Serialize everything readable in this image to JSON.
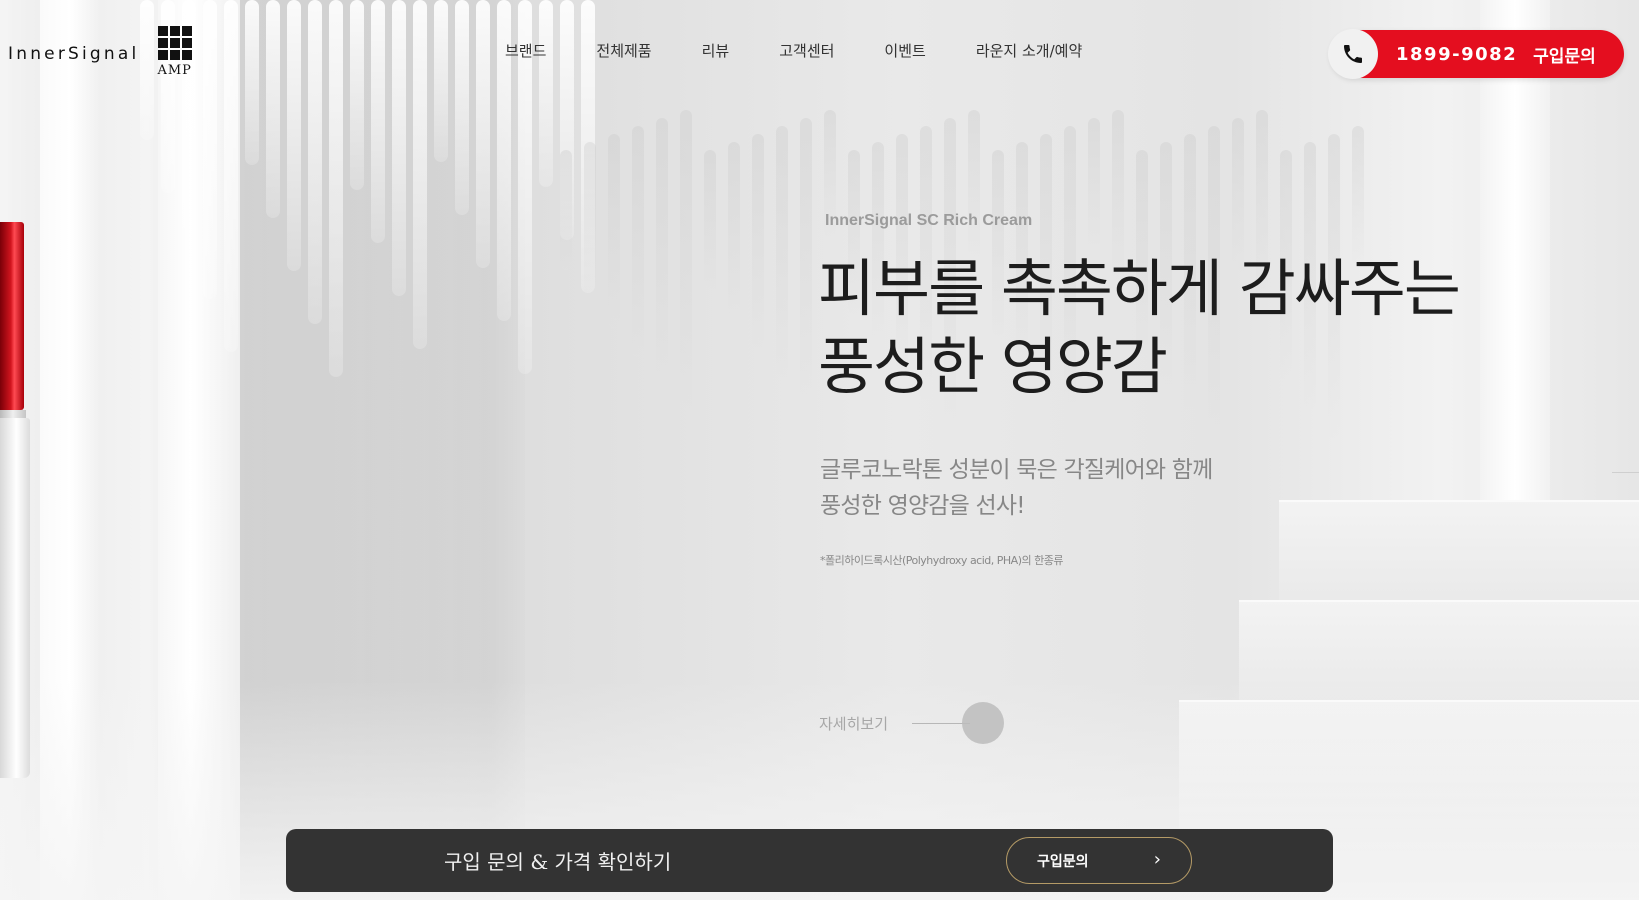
{
  "brand": {
    "name": "InnerSignal",
    "sub": "AMP"
  },
  "nav": {
    "items": [
      {
        "label": "브랜드"
      },
      {
        "label": "전체제품"
      },
      {
        "label": "리뷰"
      },
      {
        "label": "고객센터"
      },
      {
        "label": "이벤트"
      },
      {
        "label": "라운지 소개/예약"
      }
    ]
  },
  "contact_cta": {
    "phone": "1899-9082",
    "label": "구입문의",
    "phone_icon": "phone-icon",
    "accent_color": "#e40e1f"
  },
  "hero": {
    "product_name": "InnerSignal SC Rich Cream",
    "headline_line1": "피부를 촉촉하게 감싸주는",
    "headline_line2": "풍성한 영양감",
    "description_line1": "글루코노락톤 성분이 묵은 각질케어와 함께",
    "description_line2": "풍성한 영양감을 선사!",
    "footnote": "*폴리하이드록시산(Polyhydroxy acid, PHA)의 한종류",
    "more_label": "자세히보기"
  },
  "purchase_bar": {
    "text": "구입 문의 & 가격 확인하기",
    "button_label": "구입문의",
    "button_icon": "chevron-right-icon",
    "background_color": "#333333"
  }
}
